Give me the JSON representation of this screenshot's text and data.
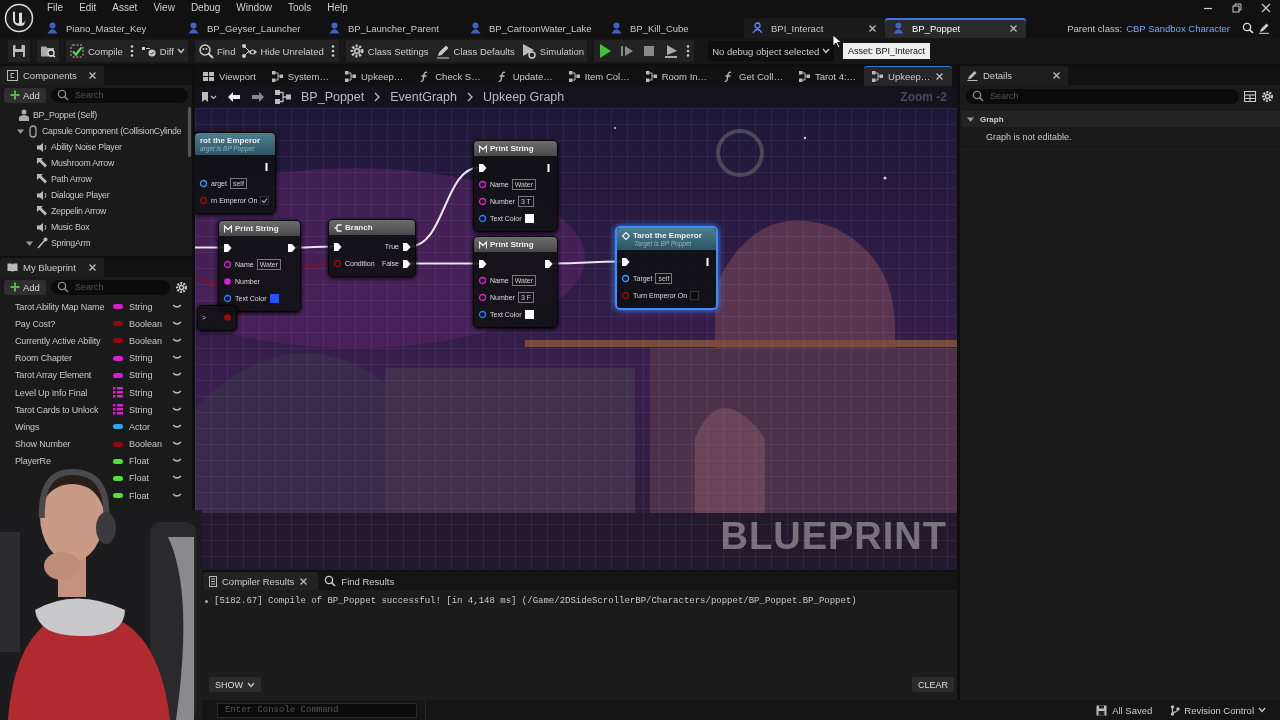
{
  "menu": [
    "File",
    "Edit",
    "Asset",
    "View",
    "Debug",
    "Window",
    "Tools",
    "Help"
  ],
  "document_tabs": [
    {
      "label": "Piano_Master_Key",
      "selected": false,
      "closable": false
    },
    {
      "label": "BP_Geyser_Launcher",
      "selected": false,
      "closable": false
    },
    {
      "label": "BP_Launcher_Parent",
      "selected": false,
      "closable": false
    },
    {
      "label": "BP_CartoonWater_Lake",
      "selected": false,
      "closable": false
    },
    {
      "label": "BP_Kill_Cube",
      "selected": false,
      "closable": false
    },
    {
      "label": "BPI_Interact",
      "selected": false,
      "closable": true
    },
    {
      "label": "BP_Poppet",
      "selected": true,
      "closable": true
    }
  ],
  "parent_class": {
    "label": "Parent class:",
    "value": "CBP Sandbox Character"
  },
  "toolbar": [
    {
      "kind": "save"
    },
    {
      "kind": "browse"
    },
    {
      "kind": "compile",
      "label": "Compile"
    },
    {
      "kind": "more"
    },
    {
      "kind": "diff",
      "label": "Diff"
    },
    {
      "kind": "find",
      "label": "Find"
    },
    {
      "kind": "hide",
      "label": "Hide Unrelated"
    },
    {
      "kind": "more"
    },
    {
      "kind": "settings",
      "label": "Class Settings"
    },
    {
      "kind": "defaults",
      "label": "Class Defaults"
    },
    {
      "kind": "simulation",
      "label": "Simulation"
    },
    {
      "kind": "play"
    },
    {
      "kind": "step"
    },
    {
      "kind": "stop"
    },
    {
      "kind": "eject"
    },
    {
      "kind": "more"
    }
  ],
  "debug_selector": {
    "value": "No debug object selected"
  },
  "tooltip": "Asset: BPI_Interact",
  "components": {
    "title": "Components",
    "add": "Add",
    "search": {
      "placeholder": "Search"
    },
    "tree": [
      {
        "label": "BP_Poppet (Self)",
        "kind": "actor",
        "children": [
          {
            "label": "Capsule Component (CollisionCylinde",
            "kind": "capsule",
            "expanded": true,
            "children": [
              {
                "label": "Ability Noise Player",
                "kind": "audio"
              },
              {
                "label": "Mushroom Arrow",
                "kind": "arrow"
              },
              {
                "label": "Path Arrow",
                "kind": "arrow"
              },
              {
                "label": "Dialogue Player",
                "kind": "audio"
              },
              {
                "label": "Zeppelin Arrow",
                "kind": "arrow"
              },
              {
                "label": "Music Box",
                "kind": "audio"
              },
              {
                "label": "SpringArm",
                "kind": "spring",
                "expanded": true
              }
            ]
          }
        ]
      }
    ]
  },
  "my_blueprint": {
    "title": "My Blueprint",
    "add": "Add",
    "search": {
      "placeholder": "Search"
    },
    "variables": [
      {
        "name": "Tarot Ability Map Name",
        "type": "String",
        "color": "#d91fd0",
        "array": false
      },
      {
        "name": "Pay Cost?",
        "type": "Boolean",
        "color": "#8e0b0b",
        "array": false
      },
      {
        "name": "Currently Active Ability",
        "type": "Boolean",
        "color": "#8e0b0b",
        "array": false
      },
      {
        "name": "Room Chapter",
        "type": "String",
        "color": "#d91fd0",
        "array": false
      },
      {
        "name": "Tarot Array Element",
        "type": "String",
        "color": "#d91fd0",
        "array": false
      },
      {
        "name": "Level Up Info Final",
        "type": "String",
        "color": "#d91fd0",
        "array": true
      },
      {
        "name": "Tarot Cards to Unlock",
        "type": "String",
        "color": "#d91fd0",
        "array": true
      },
      {
        "name": "Wings",
        "type": "Actor",
        "color": "#2aa8e6",
        "array": false
      },
      {
        "name": "Show Number",
        "type": "Boolean",
        "color": "#8e0b0b",
        "array": false
      },
      {
        "name": "PlayerRe",
        "type": "Float",
        "color": "#55e02c",
        "array": false
      },
      {
        "type": "Float",
        "color": "#55e02c",
        "array": false
      },
      {
        "type": "Float",
        "color": "#55e02c",
        "array": false
      }
    ]
  },
  "graph_tabs": [
    {
      "label": "Viewport",
      "kind": "viewport",
      "selected": false
    },
    {
      "label": "System…",
      "kind": "graph",
      "selected": false
    },
    {
      "label": "Upkeep…",
      "kind": "graph",
      "selected": false
    },
    {
      "label": "Check S…",
      "kind": "function",
      "selected": false
    },
    {
      "label": "Update…",
      "kind": "function",
      "selected": false
    },
    {
      "label": "Item Col…",
      "kind": "graph",
      "selected": false
    },
    {
      "label": "Room In…",
      "kind": "graph",
      "selected": false
    },
    {
      "label": "Get Coll…",
      "kind": "function",
      "selected": false
    },
    {
      "label": "Tarot 4:…",
      "kind": "graph",
      "selected": false
    },
    {
      "label": "Upkeep…",
      "kind": "graph",
      "selected": true
    }
  ],
  "breadcrumb": [
    "BP_Poppet",
    "EventGraph",
    "Upkeep Graph"
  ],
  "zoom": "Zoom -2",
  "watermark": "BLUEPRINT",
  "nodes": [
    {
      "kind": "function",
      "title": "rot the Emperor",
      "subtitle": "arget is BP Poppet",
      "selected": false,
      "rows": [
        {
          "out": {
            "kind": "bar"
          }
        },
        {
          "in": {
            "kind": "object",
            "label": "arget",
            "value": "self"
          }
        },
        {
          "in": {
            "kind": "bool",
            "label": "rn Emperor On",
            "checked": true
          }
        }
      ]
    },
    {
      "kind": "macro",
      "title": "Print String",
      "selected": false,
      "rows": [
        {
          "in": {
            "kind": "exec"
          },
          "out": {
            "kind": "exec"
          }
        },
        {
          "in": {
            "kind": "string",
            "label": "Name",
            "value": "Water"
          }
        },
        {
          "in": {
            "kind": "string",
            "label": "Number"
          }
        },
        {
          "in": {
            "kind": "color",
            "label": "Text Color",
            "color": "#1a55ff"
          }
        }
      ]
    },
    {
      "kind": "branch",
      "title": "Branch",
      "selected": false,
      "rows": [
        {
          "in": {
            "kind": "exec"
          },
          "out": {
            "kind": "exec",
            "label": "True"
          }
        },
        {
          "in": {
            "kind": "bool",
            "label": "Condition"
          },
          "out": {
            "kind": "exec",
            "label": "False"
          }
        }
      ]
    },
    {
      "kind": "macro",
      "title": "Print String",
      "selected": false,
      "rows": [
        {
          "in": {
            "kind": "exec"
          },
          "out": {
            "kind": "bar"
          }
        },
        {
          "in": {
            "kind": "string",
            "label": "Name",
            "value": "Water"
          }
        },
        {
          "in": {
            "kind": "string",
            "label": "Number",
            "value": "3 T"
          }
        },
        {
          "in": {
            "kind": "color",
            "label": "Text Color",
            "color": "#ffffff"
          }
        }
      ]
    },
    {
      "kind": "macro",
      "title": "Print String",
      "selected": false,
      "rows": [
        {
          "in": {
            "kind": "exec"
          },
          "out": {
            "kind": "exec"
          }
        },
        {
          "in": {
            "kind": "string",
            "label": "Name",
            "value": "Water"
          }
        },
        {
          "in": {
            "kind": "string",
            "label": "Number",
            "value": "3 F"
          }
        },
        {
          "in": {
            "kind": "color",
            "label": "Text Color",
            "color": "#ffffff"
          }
        }
      ]
    },
    {
      "kind": "function",
      "title": "Tarot the Emperor",
      "subtitle": "Target is BP Poppet",
      "selected": true,
      "rows": [
        {
          "in": {
            "kind": "exec"
          },
          "out": {
            "kind": "bar"
          }
        },
        {
          "in": {
            "kind": "object",
            "label": "Target",
            "value": "self"
          }
        },
        {
          "in": {
            "kind": "bool",
            "label": "Turn Emperor On",
            "checked": false
          }
        }
      ]
    },
    {
      "kind": "compact",
      "title": ">",
      "selected": false,
      "rows": [
        {
          "out": {
            "kind": "bool"
          }
        }
      ]
    }
  ],
  "compiler": {
    "tabs": [
      {
        "label": "Compiler Results",
        "kind": "log",
        "selected": true
      },
      {
        "label": "Find Results",
        "kind": "search",
        "selected": false
      }
    ],
    "messages": [
      "[5182.67] Compile of BP_Poppet successful! [in 4,148 ms] (/Game/2DSideScrollerBP/Characters/poppet/BP_Poppet.BP_Poppet)"
    ],
    "filter": "SHOW",
    "clear": "CLEAR"
  },
  "details": {
    "title": "Details",
    "search": {
      "placeholder": "Search"
    },
    "sections": [
      {
        "label": "Graph",
        "expanded": true,
        "rows": [
          "Graph is not editable."
        ]
      }
    ]
  },
  "status_bar": {
    "console": {
      "placeholder": "Enter Console Command"
    },
    "save_state": "All Saved",
    "revision_control": "Revision Control"
  },
  "webcam": {
    "kind": "picture"
  }
}
